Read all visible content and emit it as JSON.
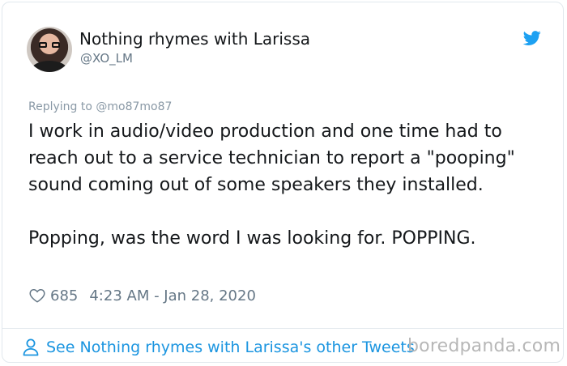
{
  "tweet": {
    "display_name": "Nothing rhymes with Larissa",
    "handle": "@XO_LM",
    "replying_to": "Replying to @mo87mo87",
    "paragraphs": [
      "I work in audio/video production and one time had to reach out to a service technician to report a \"pooping\" sound coming out of some speakers they installed.",
      "Popping, was the word I was looking for. POPPING."
    ],
    "likes": "685",
    "timestamp": "4:23 AM - Jan 28, 2020",
    "footer_link": "See Nothing rhymes with Larissa's other Tweets"
  },
  "watermark": "boredpanda.com",
  "icons": {
    "brand": "twitter-bird-icon",
    "like": "heart-icon",
    "profile": "person-icon"
  },
  "colors": {
    "twitter_blue": "#1da1f2",
    "link_blue": "#1b95e0",
    "secondary_text": "#657786",
    "primary_text": "#14171a"
  }
}
